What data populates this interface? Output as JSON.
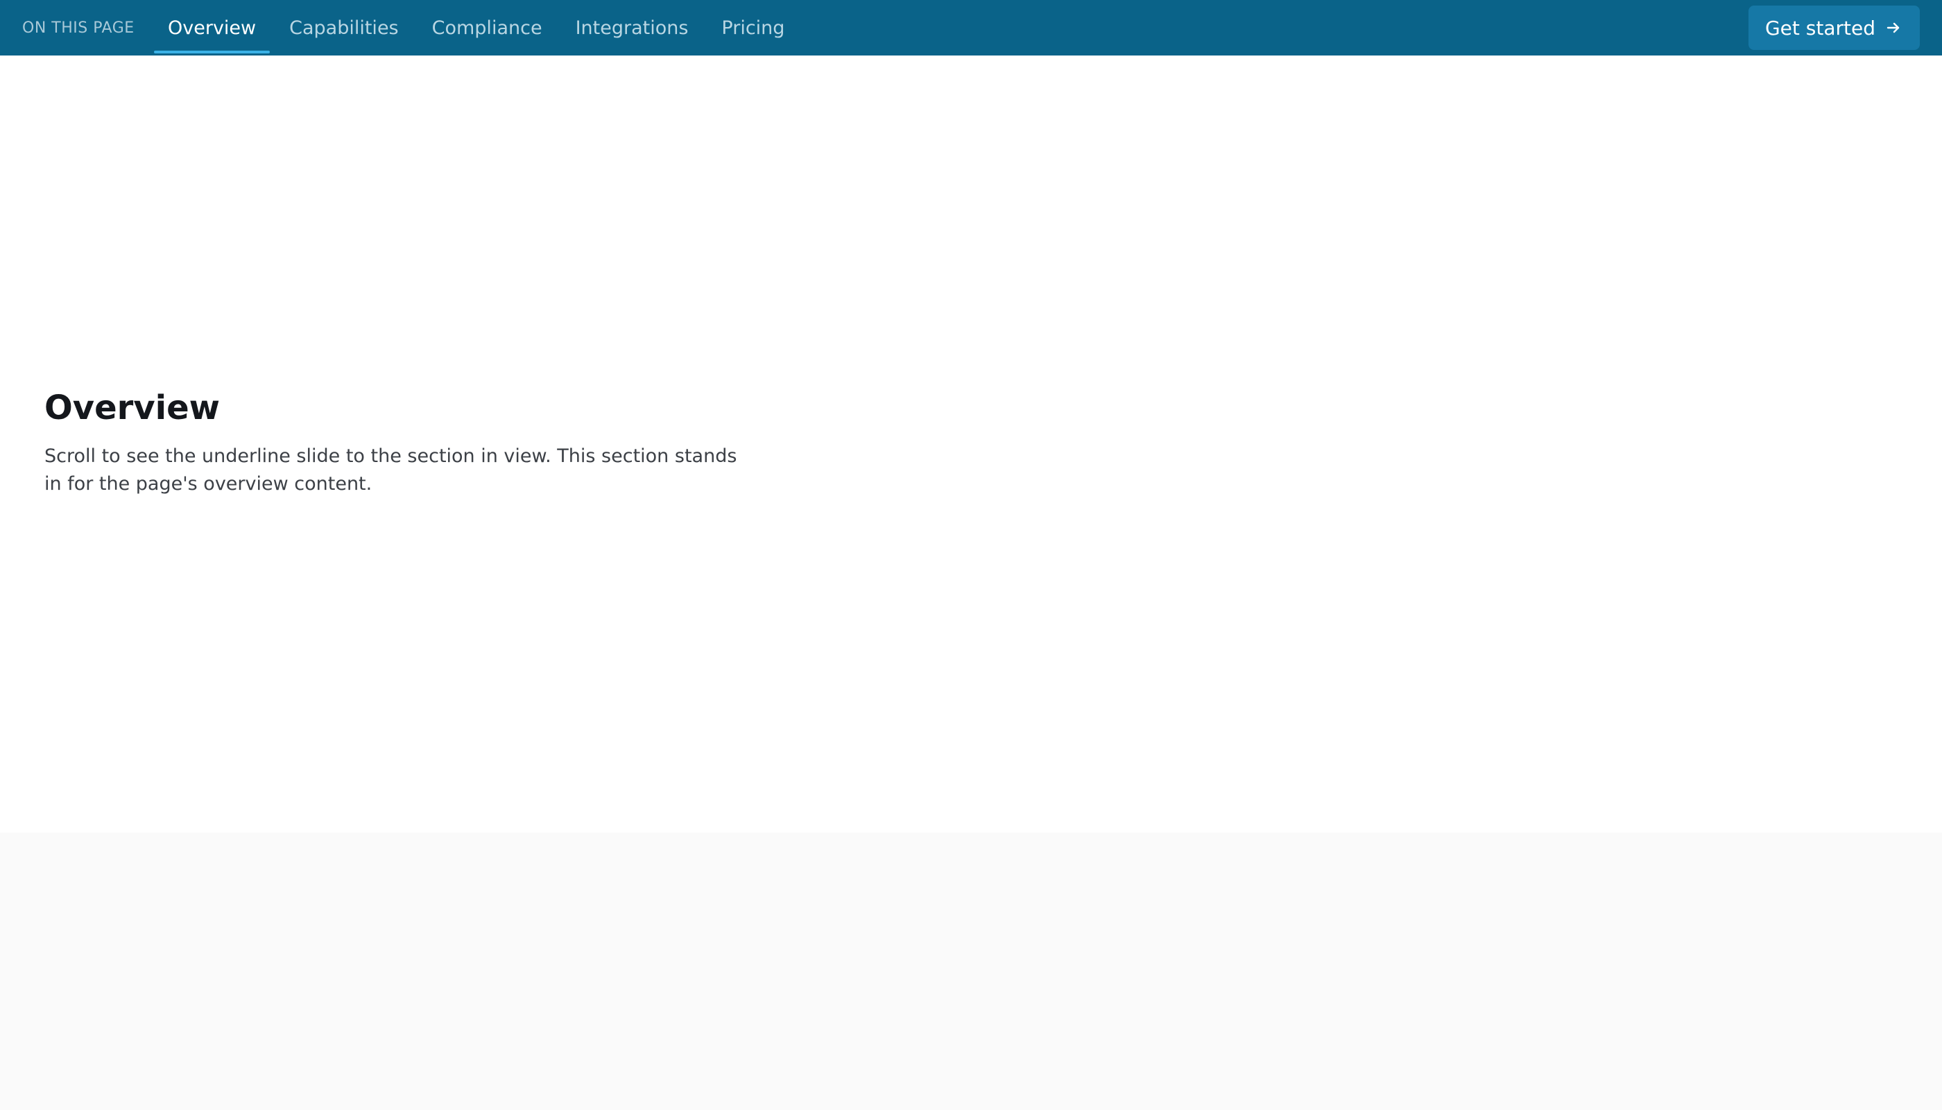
{
  "nav": {
    "label": "ON THIS PAGE",
    "tabs": [
      {
        "label": "Overview",
        "active": true
      },
      {
        "label": "Capabilities",
        "active": false
      },
      {
        "label": "Compliance",
        "active": false
      },
      {
        "label": "Integrations",
        "active": false
      },
      {
        "label": "Pricing",
        "active": false
      }
    ],
    "cta_label": "Get started",
    "cta_icon": "arrow-right-icon"
  },
  "section": {
    "title": "Overview",
    "body": "Scroll to see the underline slide to the section in view. This section stands in for the page's overview content."
  },
  "colors": {
    "nav_background": "#0a6389",
    "active_underline": "#3bb1e6",
    "cta_background": "#1678a6",
    "page_background": "#fafafa"
  }
}
